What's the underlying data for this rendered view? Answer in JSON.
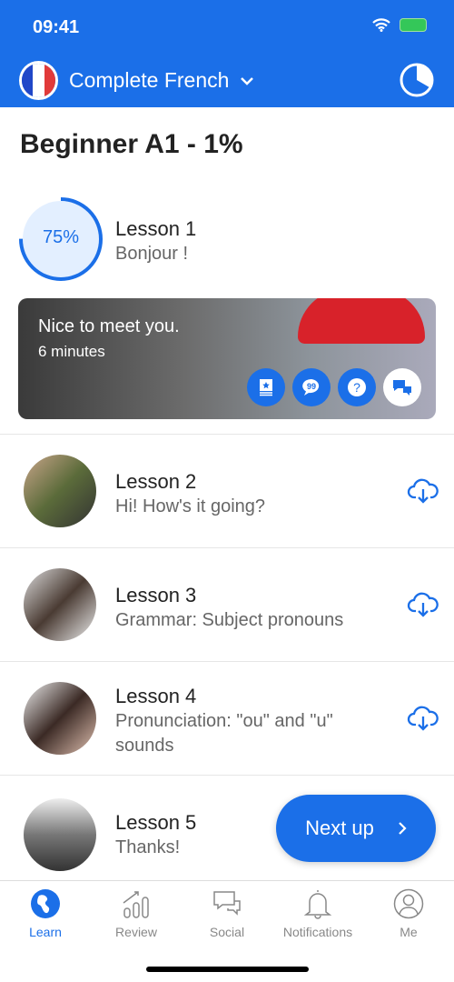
{
  "status_bar": {
    "time": "09:41"
  },
  "header": {
    "course": "Complete French"
  },
  "level": {
    "title": "Beginner A1 - 1%"
  },
  "lessons": [
    {
      "title": "Lesson 1",
      "subtitle": "Bonjour !",
      "progress_label": "75%",
      "progress": 75
    },
    {
      "title": "Lesson 2",
      "subtitle": "Hi! How's it going?"
    },
    {
      "title": "Lesson 3",
      "subtitle": "Grammar: Subject pronouns"
    },
    {
      "title": "Lesson 4",
      "subtitle": "Pronunciation: \"ou\" and \"u\" sounds"
    },
    {
      "title": "Lesson 5",
      "subtitle": "Thanks!"
    }
  ],
  "banner": {
    "title": "Nice to meet you.",
    "duration": "6 minutes",
    "actions": [
      "flashcard-icon",
      "quote-icon",
      "question-icon",
      "chat-icon"
    ]
  },
  "next_up": {
    "label": "Next up"
  },
  "tabs": [
    {
      "label": "Learn",
      "active": true
    },
    {
      "label": "Review"
    },
    {
      "label": "Social"
    },
    {
      "label": "Notifications"
    },
    {
      "label": "Me"
    }
  ],
  "colors": {
    "accent": "#1b6fe8"
  }
}
